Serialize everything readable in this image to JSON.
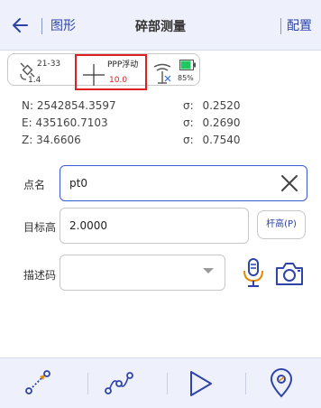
{
  "header": {
    "back_icon": "arrow-left-icon",
    "graph_link": "图形",
    "title": "碎部测量",
    "config_label": "配置",
    "accent_color": "#2e44a8",
    "background_color": "#eef1fb"
  },
  "status": {
    "satellite_icon": "satellite-icon",
    "satellite_count": "21-33",
    "pdop": "1.4",
    "solution_status": "PPP浮动",
    "solution_age": "10.0",
    "highlight_color": "#e02020",
    "antenna_icon": "antenna-icon",
    "battery_icon": "battery-icon",
    "battery_percent": "85%",
    "battery_level": 0.85,
    "battery_color": "#22c55e"
  },
  "coordinates": [
    {
      "label": "N:",
      "value": "2542854.3597",
      "sigma_label": "σ:",
      "sigma_value": "0.2520"
    },
    {
      "label": "E:",
      "value": "435160.7103",
      "sigma_label": "σ:",
      "sigma_value": "0.2690"
    },
    {
      "label": "Z:",
      "value": "34.6606",
      "sigma_label": "σ:",
      "sigma_value": "0.7540"
    }
  ],
  "form": {
    "point_name_label": "点名",
    "point_name_value": "pt0",
    "target_height_label": "目标高",
    "target_height_value": "2.0000",
    "pole_height_button": "杆高(P)",
    "description_label": "描述码",
    "description_value": "",
    "clear_icon": "close-x-icon",
    "mic_icon": "microphone-icon",
    "camera_icon": "camera-icon"
  },
  "toolbar": {
    "items": [
      {
        "name": "point-measure-icon"
      },
      {
        "name": "line-measure-icon"
      },
      {
        "name": "play-icon"
      },
      {
        "name": "stakeout-pin-icon"
      }
    ],
    "icon_color": "#2e44a8"
  }
}
